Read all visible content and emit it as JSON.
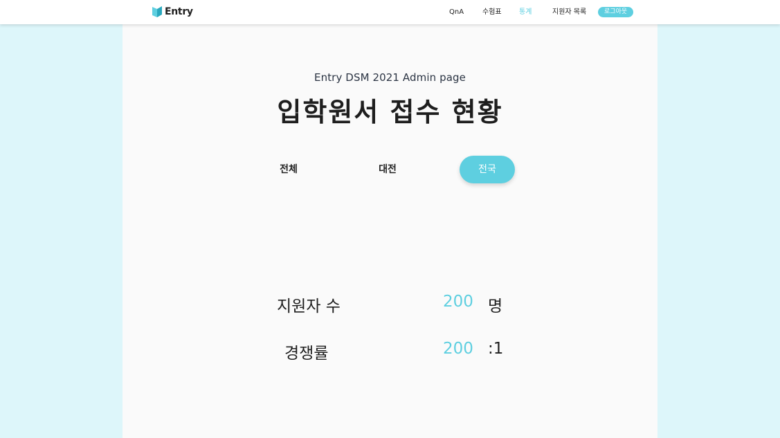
{
  "header": {
    "logo_text": "Entry",
    "nav": {
      "qna": "QnA",
      "exam_ticket": "수험표",
      "statistics": "통계",
      "applicant_list": "지원자 목록"
    },
    "logout_label": "로그아웃",
    "active_nav": "statistics"
  },
  "main": {
    "subtitle": "Entry DSM 2021 Admin page",
    "title": "입학원서 접수 현황",
    "tabs": {
      "all": "전체",
      "daejeon": "대전",
      "nationwide": "전국"
    },
    "active_tab": "nationwide",
    "stats": {
      "applicants": {
        "label": "지원자 수",
        "value": "200",
        "unit": "명"
      },
      "competition": {
        "label": "경쟁률",
        "value": "200",
        "unit": ":1"
      }
    }
  },
  "colors": {
    "accent": "#5ecfe0",
    "page_background": "#ddf6fa",
    "panel_background": "#fafafa",
    "text": "#1e1e1e"
  },
  "icons": {
    "logo": "entry-logo-icon"
  }
}
